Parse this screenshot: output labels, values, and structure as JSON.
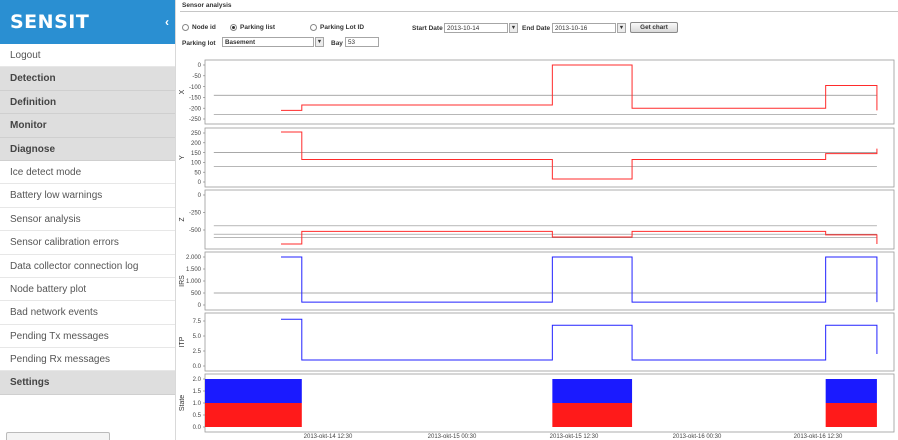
{
  "app": {
    "brand": "SENSIT",
    "collapse_glyph": "‹"
  },
  "sidebar": {
    "items": [
      {
        "label": "Logout",
        "section": false
      },
      {
        "label": "Detection",
        "section": true
      },
      {
        "label": "Definition",
        "section": true
      },
      {
        "label": "Monitor",
        "section": true
      },
      {
        "label": "Diagnose",
        "section": true
      },
      {
        "label": "Ice detect mode",
        "section": false
      },
      {
        "label": "Battery low warnings",
        "section": false
      },
      {
        "label": "Sensor analysis",
        "section": false
      },
      {
        "label": "Sensor calibration errors",
        "section": false
      },
      {
        "label": "Data collector connection log",
        "section": false
      },
      {
        "label": "Node battery plot",
        "section": false
      },
      {
        "label": "Bad network events",
        "section": false
      },
      {
        "label": "Pending Tx messages",
        "section": false
      },
      {
        "label": "Pending Rx messages",
        "section": false
      },
      {
        "label": "Settings",
        "section": true
      }
    ]
  },
  "controls": {
    "title": "Sensor analysis",
    "radio_node": "Node id",
    "radio_list": "Parking list",
    "radio_lot": "Parking Lot ID",
    "selected_radio": "Parking list",
    "start_label": "Start Date",
    "start_value": "2013-10-14",
    "end_label": "End Date",
    "end_value": "2013-10-16",
    "get_chart": "Get chart",
    "lot_label": "Parking lot",
    "lot_value": "Basement",
    "bay_label": "Bay",
    "bay_value": "53",
    "dropdown_glyph": "▼"
  },
  "colors": {
    "red": "#ff2b2b",
    "blue": "#2222ff",
    "gray": "#8c8c8c",
    "brand": "#2a8fd2"
  },
  "chart_data": {
    "type": "line",
    "x_ticks": [
      "2013-okt-14 12:30",
      "2013-okt-15 00:30",
      "2013-okt-15 12:30",
      "2013-okt-16 00:30",
      "2013-okt-16 12:30"
    ],
    "x_range": [
      "2013-10-14 06:00",
      "2013-10-16 18:30"
    ],
    "transitions": [
      "2013-10-14 14:30",
      "2013-10-15 12:30",
      "2013-10-15 19:30",
      "2013-10-16 12:30",
      "2013-10-16 17:00"
    ],
    "panels": [
      {
        "name": "X",
        "ylabel": "X",
        "color": "red",
        "ylim": [
          -250,
          0
        ],
        "ticks": [
          "0",
          "-50",
          "-100",
          "-150",
          "-200",
          "-250"
        ],
        "tick_values": [
          0,
          -50,
          -100,
          -150,
          -200,
          -250
        ],
        "levels": [
          -210,
          -185,
          0,
          -200,
          -95,
          -210
        ],
        "ref_lines": [
          -140,
          -230
        ]
      },
      {
        "name": "Y",
        "ylabel": "Y",
        "color": "red",
        "ylim": [
          0,
          250
        ],
        "ticks": [
          "250",
          "200",
          "150",
          "100",
          "50",
          "0"
        ],
        "tick_values": [
          250,
          200,
          150,
          100,
          50,
          0
        ],
        "levels": [
          255,
          115,
          15,
          115,
          145,
          170
        ],
        "ref_lines": [
          150,
          80
        ]
      },
      {
        "name": "Z",
        "ylabel": "Z",
        "color": "red",
        "ylim": [
          -700,
          0
        ],
        "ticks": [
          "0",
          "-250",
          "-500"
        ],
        "tick_values": [
          0,
          -250,
          -500
        ],
        "levels": [
          -700,
          -520,
          -600,
          -520,
          -570,
          -700
        ],
        "ref_lines": [
          -440,
          -560,
          -610
        ]
      },
      {
        "name": "IRS",
        "ylabel": "IRS",
        "color": "blue",
        "ylim": [
          0,
          2000
        ],
        "ticks": [
          "2.000",
          "1.500",
          "1.000",
          "500",
          "0"
        ],
        "tick_values": [
          2000,
          1500,
          1000,
          500,
          0
        ],
        "levels": [
          2000,
          120,
          2000,
          120,
          2000,
          120
        ],
        "ref_lines": [
          500
        ]
      },
      {
        "name": "ITP",
        "ylabel": "ITP",
        "color": "blue",
        "ylim": [
          0,
          8
        ],
        "ticks": [
          "7.5",
          "5.0",
          "2.5",
          "0.0"
        ],
        "tick_values": [
          7.5,
          5.0,
          2.5,
          0.0
        ],
        "levels": [
          7.8,
          1.0,
          6.8,
          1.0,
          6.8,
          2.0
        ],
        "ref_lines": []
      },
      {
        "name": "State",
        "ylabel": "State",
        "type": "stacked-bar",
        "ylim": [
          0,
          2
        ],
        "ticks": [
          "2.0",
          "1.5",
          "1.0",
          "0.5",
          "0.0"
        ],
        "tick_values": [
          2.0,
          1.5,
          1.0,
          0.5,
          0.0
        ],
        "bars": [
          {
            "start": "2013-10-14 06:00",
            "end": "2013-10-14 14:30",
            "red": 1.0,
            "blue": 1.0
          },
          {
            "start": "2013-10-15 12:30",
            "end": "2013-10-15 19:30",
            "red": 1.0,
            "blue": 1.0
          },
          {
            "start": "2013-10-16 12:30",
            "end": "2013-10-16 17:00",
            "red": 1.0,
            "blue": 1.0
          }
        ]
      }
    ]
  }
}
